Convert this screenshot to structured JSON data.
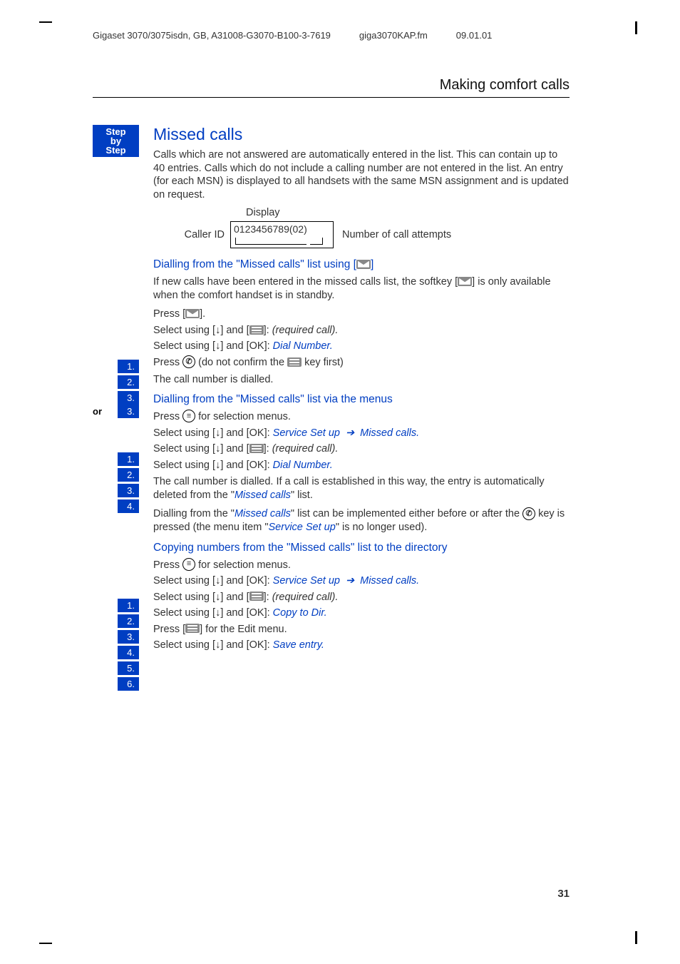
{
  "header": {
    "doc": "Gigaset 3070/3075isdn, GB, A31008-G3070-B100-3-7619",
    "file": "giga3070KAP.fm",
    "date": "09.01.01",
    "pageTitle": "Making comfort calls"
  },
  "stepBadge": {
    "l1": "Step",
    "l2": "by",
    "l3": "Step"
  },
  "missed": {
    "title": "Missed calls",
    "intro": "Calls which are not answered are automatically entered in the list. This can contain up to 40 entries. Calls which do not include a calling number are not entered in the list. An entry (for each MSN) is displayed to all handsets with the same MSN assignment and is updated on request.",
    "display": {
      "label": "Display",
      "code": "0123456789(02)",
      "callerId": "Caller ID",
      "attempts": "Number of call attempts"
    }
  },
  "dialSoft": {
    "title_a": "Dialling from the ",
    "title_b": "\"Missed calls\"",
    "title_c": " list using [",
    "title_d": "]",
    "intro_a": "If new calls have been entered in the missed calls list, the softkey [",
    "intro_b": "] is only available when the comfort handset is in standby.",
    "s1_a": "Press [",
    "s1_b": "].",
    "s2_a": "Select using [",
    "s2_b": "] and [",
    "s2_c": "]: ",
    "s2_req": "(required call).",
    "s3_a": "Select using [",
    "s3_b": "] and [OK]: ",
    "s3_item": "Dial Number.",
    "or3_a": "Press ",
    "or3_b": " (do not confirm the ",
    "or3_c": " key first)",
    "result": "The call number is dialled."
  },
  "dialMenu": {
    "title_a": "Dialling from the ",
    "title_b": "\"Missed calls\"",
    "title_c": " list via the menus",
    "s1_a": "Press ",
    "s1_b": " for selection menus.",
    "s2_a": "Select using [",
    "s2_b": "] and [OK]: ",
    "s2_item": "Service Set up",
    "s2_item2": "Missed calls",
    "s3_a": "Select using [",
    "s3_b": "] and [",
    "s3_c": "]: ",
    "s3_req": "(required call).",
    "s4_a": "Select using [",
    "s4_b": "] and [OK]: ",
    "s4_item": "Dial Number.",
    "res1": "The call number is dialled. If a call is established in this way, the entry is automatically deleted from the \"",
    "res1_item": "Missed calls",
    "res1_end": "\" list.",
    "res2_a": "Dialling from the \"",
    "res2_item": "Missed calls",
    "res2_b": "\" list can be implemented either before or after the ",
    "res2_c": " key is pressed (the menu item \"",
    "res2_item2": "Service Set up",
    "res2_d": "\" is no longer used)."
  },
  "copyDir": {
    "title_a": "Copying numbers from the ",
    "title_b": "\"Missed calls\"",
    "title_c": " list to the directory",
    "s1_a": "Press ",
    "s1_b": " for selection menus.",
    "s2_a": "Select using [",
    "s2_b": "] and [OK]: ",
    "s2_item": "Service Set up",
    "s2_item2": "Missed calls",
    "s3_a": "Select using [",
    "s3_b": "] and [",
    "s3_c": "]: ",
    "s3_req": "(required call).",
    "s4_a": "Select using [",
    "s4_b": "] and [OK]: ",
    "s4_item": "Copy to Dir.",
    "s5_a": "Press [",
    "s5_b": "] for the Edit menu.",
    "s6_a": "Select using [",
    "s6_b": "] and [OK]: ",
    "s6_item": "Save entry."
  },
  "orLabel": "or",
  "nums": {
    "n1": "1.",
    "n2": "2.",
    "n3": "3.",
    "n4": "4.",
    "n5": "5.",
    "n6": "6."
  },
  "arrowDown": "↓",
  "menuGlyph": "≡",
  "handsetGlyph": "✆",
  "arrowRight": "➔",
  "dot": ".",
  "pageNumber": "31"
}
